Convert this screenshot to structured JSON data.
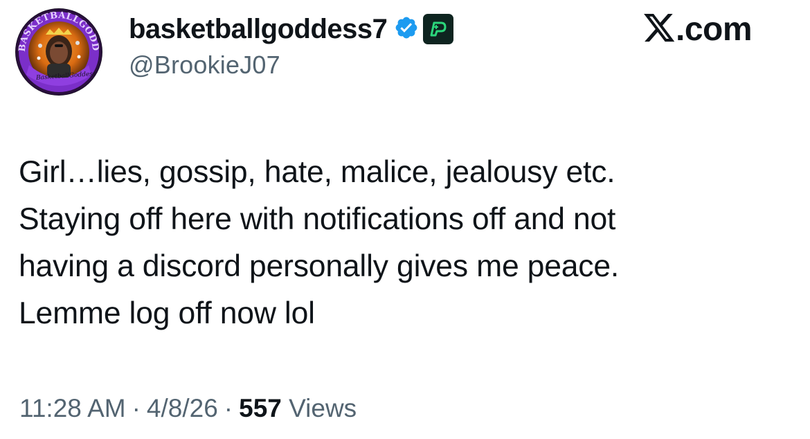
{
  "author": {
    "display_name": "basketballgoddess7",
    "handle": "@BrookieJ07",
    "avatar": {
      "arc_text": "BASKETBALLGODDESS",
      "watermark": "BasketballGoddess",
      "ring_color": "#7b2fc9",
      "inner_color": "#e77b16"
    },
    "verified_icon": "verified-badge-icon",
    "affiliate_icon": "sportsbook-app-icon"
  },
  "brand": {
    "logo_icon": "x-logo-icon",
    "domain_suffix": ".com"
  },
  "tweet": {
    "lines": [
      "Girl…lies, gossip, hate, malice, jealousy etc.",
      "Staying off here with notifications off and not",
      "having a discord personally gives me peace.",
      "Lemme log off now lol"
    ]
  },
  "meta": {
    "time": "11:28 AM",
    "date": "4/8/26",
    "separator": "·",
    "views_count": "557",
    "views_label": "Views"
  },
  "colors": {
    "text_primary": "#0f1419",
    "text_secondary": "#536471",
    "verified_blue": "#1d9bf0",
    "affiliate_bg": "#0e2420",
    "affiliate_green": "#2bd67b"
  }
}
